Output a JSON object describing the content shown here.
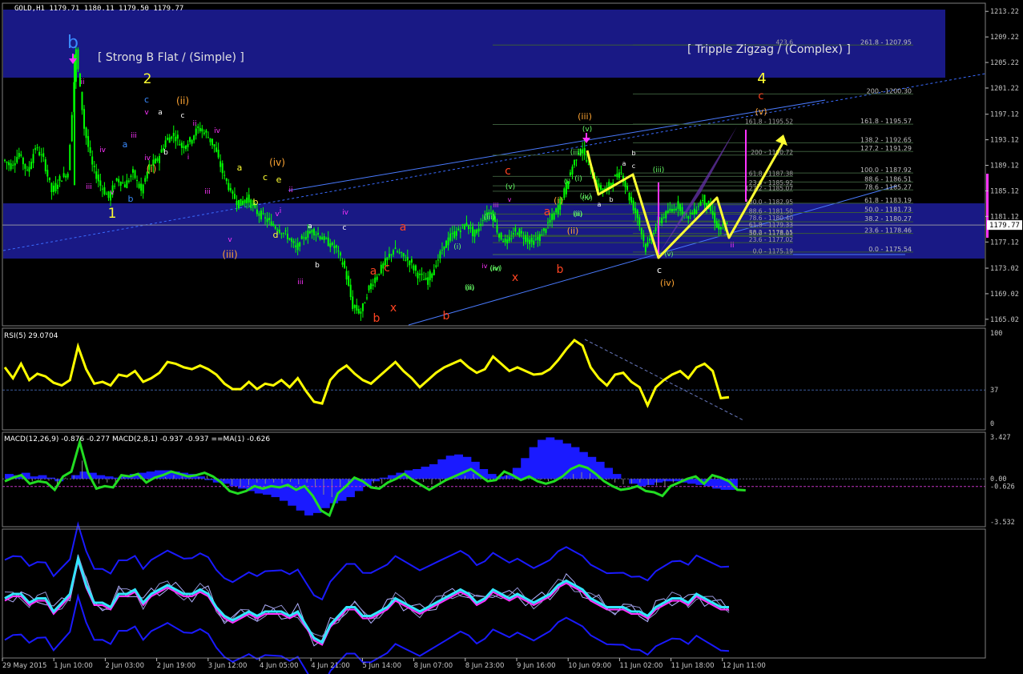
{
  "window": {
    "symbol_header": "GOLD,H1  1179.71 1180.11 1179.50 1179.77",
    "current_price": "1179.77"
  },
  "colors": {
    "background": "#000000",
    "candle": "#00ff00",
    "band": "#1a1a8c",
    "wave_yellow": "#ffff33",
    "wave_blue": "#3a8bff",
    "wave_magenta": "#ff33ff",
    "wave_red": "#ff4422",
    "wave_orange": "#ffa533",
    "wave_green": "#66ff66",
    "rsi": "#ffff00",
    "macd_hist": "#1a1aff",
    "macd_signal": "#22dd22",
    "axis_text": "#c8c8c8"
  },
  "annotations": {
    "strong_b_flat": "[ Strong B Flat / (Simple) ]",
    "tripple_zigzag": "[ Tripple Zigzag / (Complex) ]"
  },
  "chart_data": [
    {
      "type": "candlestick",
      "title": "GOLD,H1",
      "ohlc_header": [
        1179.71,
        1180.11,
        1179.5,
        1179.77
      ],
      "ylim": [
        1164.0,
        1214.5
      ],
      "y_ticks": [
        "1213.22",
        "1209.22",
        "1205.22",
        "1201.22",
        "1197.12",
        "1193.12",
        "1189.12",
        "1185.12",
        "1181.12",
        "1177.12",
        "1173.02",
        "1169.02",
        "1165.02"
      ],
      "x_ticks": [
        "29 May 2015",
        "1 Jun 10:00",
        "2 Jun 03:00",
        "2 Jun 19:00",
        "3 Jun 12:00",
        "4 Jun 05:00",
        "4 Jun 21:00",
        "5 Jun 14:00",
        "8 Jun 07:00",
        "8 Jun 23:00",
        "9 Jun 16:00",
        "10 Jun 09:00",
        "11 Jun 02:00",
        "11 Jun 18:00",
        "12 Jun 11:00"
      ],
      "close_path_approx": [
        1190,
        1189,
        1191,
        1188,
        1192,
        1190,
        1185,
        1187,
        1188,
        1207,
        1195,
        1189,
        1186,
        1184,
        1187,
        1186,
        1188,
        1185,
        1189,
        1190,
        1193,
        1194,
        1192,
        1193,
        1195,
        1194,
        1192,
        1188,
        1185,
        1183,
        1184,
        1182,
        1181,
        1180,
        1179,
        1178,
        1176,
        1178,
        1179,
        1178,
        1177,
        1176,
        1173,
        1167,
        1166,
        1170,
        1172,
        1174,
        1176,
        1175,
        1174,
        1172,
        1171,
        1173,
        1176,
        1178,
        1179,
        1180,
        1178,
        1181,
        1182,
        1178,
        1177,
        1179,
        1178,
        1177,
        1178,
        1180,
        1182,
        1185,
        1189,
        1192,
        1189,
        1186,
        1185,
        1187,
        1188,
        1184,
        1181,
        1176,
        1179,
        1181,
        1182,
        1183,
        1181,
        1182,
        1184,
        1182,
        1179,
        1179.77
      ],
      "wave_labels": [
        {
          "text": "b",
          "color": "#3a8bff"
        },
        {
          "text": "ii",
          "color": "#ff33ff"
        },
        {
          "text": "iv",
          "color": "#ff33ff"
        },
        {
          "text": "iii",
          "color": "#ff33ff"
        },
        {
          "text": "v",
          "color": "#ff33ff"
        },
        {
          "text": "a",
          "color": "#3a8bff"
        },
        {
          "text": "b",
          "color": "#3a8bff"
        },
        {
          "text": "1",
          "color": "#ffff33"
        },
        {
          "text": "2",
          "color": "#ffff33"
        },
        {
          "text": "c",
          "color": "#3a8bff"
        },
        {
          "text": "v",
          "color": "#ff33ff"
        },
        {
          "text": "iii",
          "color": "#ff33ff"
        },
        {
          "text": "(i)",
          "color": "#ffa533"
        },
        {
          "text": "iv",
          "color": "#ff33ff"
        },
        {
          "text": "a",
          "color": "#ffffff"
        },
        {
          "text": "b",
          "color": "#ffffff"
        },
        {
          "text": "c",
          "color": "#ffffff"
        },
        {
          "text": "(ii)",
          "color": "#ffa533"
        },
        {
          "text": "ii",
          "color": "#ff33ff"
        },
        {
          "text": "i",
          "color": "#ff33ff"
        },
        {
          "text": "iv",
          "color": "#ff33ff"
        },
        {
          "text": "iii",
          "color": "#ff33ff"
        },
        {
          "text": "v",
          "color": "#ff33ff"
        },
        {
          "text": "(iii)",
          "color": "#ffa533"
        },
        {
          "text": "a",
          "color": "#ffff33"
        },
        {
          "text": "b",
          "color": "#ffff33"
        },
        {
          "text": "c",
          "color": "#ffff33"
        },
        {
          "text": "d",
          "color": "#ffff33"
        },
        {
          "text": "e",
          "color": "#ffff33"
        },
        {
          "text": "(iv)",
          "color": "#ffa533"
        },
        {
          "text": "i",
          "color": "#ff33ff"
        },
        {
          "text": "ii",
          "color": "#ff33ff"
        },
        {
          "text": "iii",
          "color": "#ff33ff"
        },
        {
          "text": "iv",
          "color": "#ff33ff"
        },
        {
          "text": "v",
          "color": "#ff33ff"
        },
        {
          "text": "a",
          "color": "#ffffff"
        },
        {
          "text": "b",
          "color": "#ffffff"
        },
        {
          "text": "c",
          "color": "#ffffff"
        },
        {
          "text": "a",
          "color": "#ff4422"
        },
        {
          "text": "b",
          "color": "#ff4422"
        },
        {
          "text": "c",
          "color": "#ff4422"
        },
        {
          "text": "x",
          "color": "#ff4422"
        },
        {
          "text": "a",
          "color": "#ff4422"
        },
        {
          "text": "b",
          "color": "#ff4422"
        },
        {
          "text": "c",
          "color": "#ff4422"
        },
        {
          "text": "x",
          "color": "#ff4422"
        },
        {
          "text": "a",
          "color": "#ff4422"
        },
        {
          "text": "b",
          "color": "#ff4422"
        },
        {
          "text": "(i)",
          "color": "#66ff66"
        },
        {
          "text": "(ii)",
          "color": "#66ff66"
        },
        {
          "text": "(iii)",
          "color": "#66ff66"
        },
        {
          "text": "(iv)",
          "color": "#66ff66"
        },
        {
          "text": "(v)",
          "color": "#66ff66"
        },
        {
          "text": "(i)",
          "color": "#ffa533"
        },
        {
          "text": "(ii)",
          "color": "#ffa533"
        },
        {
          "text": "(iii)",
          "color": "#ffa533"
        },
        {
          "text": "(iv)",
          "color": "#ffa533"
        },
        {
          "text": "(v)",
          "color": "#ffa533"
        },
        {
          "text": "(i)",
          "color": "#66ff66"
        },
        {
          "text": "(ii)",
          "color": "#66ff66"
        },
        {
          "text": "(iii)",
          "color": "#66ff66"
        },
        {
          "text": "(iv)",
          "color": "#66ff66"
        },
        {
          "text": "(v)",
          "color": "#66ff66"
        },
        {
          "text": "4",
          "color": "#ffff33"
        },
        {
          "text": "c",
          "color": "#ff4422"
        },
        {
          "text": "c",
          "color": "#ffffff"
        },
        {
          "text": "(iii)",
          "color": "#66ff66"
        },
        {
          "text": "ii",
          "color": "#ff33ff"
        }
      ],
      "fib_levels_right": [
        {
          "label": "261.8 - 1207.95",
          "price": 1207.95
        },
        {
          "label": "200 - 1200.30",
          "price": 1200.3
        },
        {
          "label": "161.8 - 1195.57",
          "price": 1195.57
        },
        {
          "label": "138.2 - 1192.65",
          "price": 1192.65
        },
        {
          "label": "127.2 - 1191.29",
          "price": 1191.29
        },
        {
          "label": "100.0 - 1187.92",
          "price": 1187.92
        },
        {
          "label": "88.6 - 1186.51",
          "price": 1186.51
        },
        {
          "label": "78.6 - 1185.27",
          "price": 1185.27
        },
        {
          "label": "61.8 - 1183.19",
          "price": 1183.19
        },
        {
          "label": "50.0 - 1181.73",
          "price": 1181.73
        },
        {
          "label": "38.2 - 1180.27",
          "price": 1180.27
        },
        {
          "label": "23.6 - 1178.46",
          "price": 1178.46
        },
        {
          "label": "0.0 - 1175.54",
          "price": 1175.54
        }
      ],
      "fib_levels_left": [
        {
          "label": "423.6",
          "price": 1207.95
        },
        {
          "label": "161.8 - 1195.52",
          "price": 1195.52
        },
        {
          "label": "200 - 1190.72",
          "price": 1190.72
        },
        {
          "label": "61.8 - 1187.38",
          "price": 1187.38
        },
        {
          "label": "23.6 - 1185.92",
          "price": 1185.92
        },
        {
          "label": "127.2 - 1185.07",
          "price": 1185.07
        },
        {
          "label": "100.0 - 1182.95",
          "price": 1182.95
        },
        {
          "label": "88.6 - 1181.50",
          "price": 1181.5
        },
        {
          "label": "78.6 - 1180.40",
          "price": 1180.4
        },
        {
          "label": "61.8 - 1179.33",
          "price": 1179.33
        },
        {
          "label": "50.0 - 1178.01",
          "price": 1178.01
        },
        {
          "label": "38.2 - 1178.15",
          "price": 1178.15
        },
        {
          "label": "23.6 - 1177.02",
          "price": 1177.02
        },
        {
          "label": "0.0 - 1175.19",
          "price": 1175.19
        }
      ]
    },
    {
      "type": "line",
      "title": "RSI(5) 29.0704",
      "ylim": [
        0,
        100
      ],
      "y_ticks": [
        "100",
        "37",
        "0"
      ],
      "level": 37,
      "values": [
        62,
        50,
        66,
        48,
        55,
        52,
        45,
        42,
        48,
        85,
        60,
        44,
        46,
        42,
        54,
        52,
        58,
        46,
        50,
        56,
        68,
        66,
        62,
        60,
        64,
        60,
        54,
        44,
        38,
        38,
        46,
        38,
        44,
        42,
        48,
        40,
        50,
        36,
        24,
        22,
        48,
        58,
        64,
        55,
        48,
        44,
        52,
        60,
        68,
        58,
        50,
        40,
        48,
        56,
        62,
        66,
        70,
        62,
        56,
        60,
        74,
        66,
        58,
        62,
        58,
        54,
        55,
        60,
        70,
        82,
        92,
        86,
        62,
        50,
        42,
        54,
        56,
        46,
        40,
        20,
        40,
        48,
        54,
        58,
        50,
        62,
        66,
        58,
        28,
        29
      ]
    },
    {
      "type": "bar",
      "title": "MACD(12,26,9) -0.876 -0.277  MACD(2,8,1) -0.937 -0.937  ==MA(1) -0.626",
      "ylim": [
        -3.532,
        3.427
      ],
      "y_ticks": [
        "3.427",
        "0.00",
        "-0.626",
        "-3.532"
      ],
      "series": [
        {
          "values": [
            0.4,
            0.3,
            0.5,
            0.2,
            0.3,
            0.1,
            -0.2,
            0.0,
            0.3,
            0.6,
            0.5,
            0.3,
            0.2,
            0.1,
            0.3,
            0.4,
            0.5,
            0.6,
            0.7,
            0.7,
            0.6,
            0.5,
            0.4,
            0.2,
            -0.1,
            -0.3,
            -0.4,
            -0.6,
            -0.8,
            -1.0,
            -1.2,
            -1.3,
            -1.5,
            -1.8,
            -2.2,
            -2.6,
            -3.0,
            -2.8,
            -2.4,
            -2.0,
            -1.8,
            -1.5,
            -1.0,
            -0.6,
            -0.2,
            0.1,
            0.3,
            0.5,
            0.7,
            0.8,
            1.0,
            1.2,
            1.6,
            1.9,
            2.0,
            1.8,
            1.4,
            0.8,
            0.4,
            0.2,
            0.3,
            0.9,
            1.7,
            2.6,
            3.2,
            3.4,
            3.2,
            2.9,
            2.6,
            2.2,
            1.8,
            1.4,
            0.9,
            0.4,
            0.0,
            -0.4,
            -0.6,
            -0.5,
            -0.3,
            -0.2,
            -0.2,
            -0.3,
            -0.4,
            -0.5,
            -0.6,
            -0.8,
            -0.9,
            -0.9
          ]
        },
        {
          "values": [
            -0.2,
            0.1,
            0.3,
            -0.4,
            -0.2,
            -0.3,
            -0.9,
            0.2,
            0.6,
            3.0,
            0.5,
            -0.8,
            -0.6,
            -0.7,
            0.3,
            0.2,
            0.4,
            -0.3,
            0.1,
            0.3,
            0.6,
            0.4,
            0.2,
            0.3,
            0.5,
            0.2,
            -0.3,
            -1.0,
            -1.2,
            -1.0,
            -0.6,
            -0.8,
            -0.6,
            -0.7,
            -0.5,
            -0.9,
            -0.6,
            -1.4,
            -2.6,
            -3.0,
            -1.2,
            -0.6,
            0.1,
            -0.2,
            -0.7,
            -0.8,
            -0.3,
            0.0,
            0.4,
            -0.1,
            -0.5,
            -0.9,
            -0.5,
            -0.1,
            0.2,
            0.5,
            0.8,
            0.3,
            -0.2,
            -0.1,
            0.6,
            0.3,
            -0.1,
            0.2,
            -0.2,
            -0.4,
            -0.2,
            0.2,
            0.8,
            1.1,
            0.9,
            0.4,
            -0.2,
            -0.6,
            -0.9,
            -0.8,
            -0.6,
            -1.0,
            -1.1,
            -1.4,
            -0.6,
            -0.3,
            0.0,
            0.2,
            -0.4,
            0.3,
            0.1,
            -0.2,
            -0.9,
            -0.937
          ]
        }
      ]
    },
    {
      "type": "line",
      "title": "",
      "series": [
        {
          "values": [
            0.0,
            0.1,
            0.1,
            -0.1,
            0.0,
            0.0,
            -0.3,
            -0.1,
            0.1,
            0.9,
            0.3,
            -0.1,
            -0.1,
            -0.2,
            0.1,
            0.1,
            0.2,
            -0.1,
            0.1,
            0.2,
            0.3,
            0.2,
            0.1,
            0.1,
            0.2,
            0.1,
            -0.2,
            -0.4,
            -0.5,
            -0.4,
            -0.3,
            -0.4,
            -0.3,
            -0.3,
            -0.3,
            -0.4,
            -0.3,
            -0.6,
            -0.9,
            -1.0,
            -0.6,
            -0.4,
            -0.2,
            -0.2,
            -0.4,
            -0.4,
            -0.3,
            -0.2,
            0.0,
            -0.1,
            -0.2,
            -0.3,
            -0.2,
            -0.1,
            0.0,
            0.1,
            0.2,
            0.1,
            -0.1,
            0.0,
            0.2,
            0.1,
            0.0,
            0.1,
            0.0,
            -0.1,
            0.0,
            0.1,
            0.3,
            0.4,
            0.3,
            0.2,
            0.0,
            -0.1,
            -0.2,
            -0.2,
            -0.2,
            -0.3,
            -0.3,
            -0.4,
            -0.2,
            -0.1,
            0.0,
            0.0,
            -0.1,
            0.1,
            0.0,
            -0.1,
            -0.2,
            -0.2
          ]
        }
      ]
    }
  ]
}
